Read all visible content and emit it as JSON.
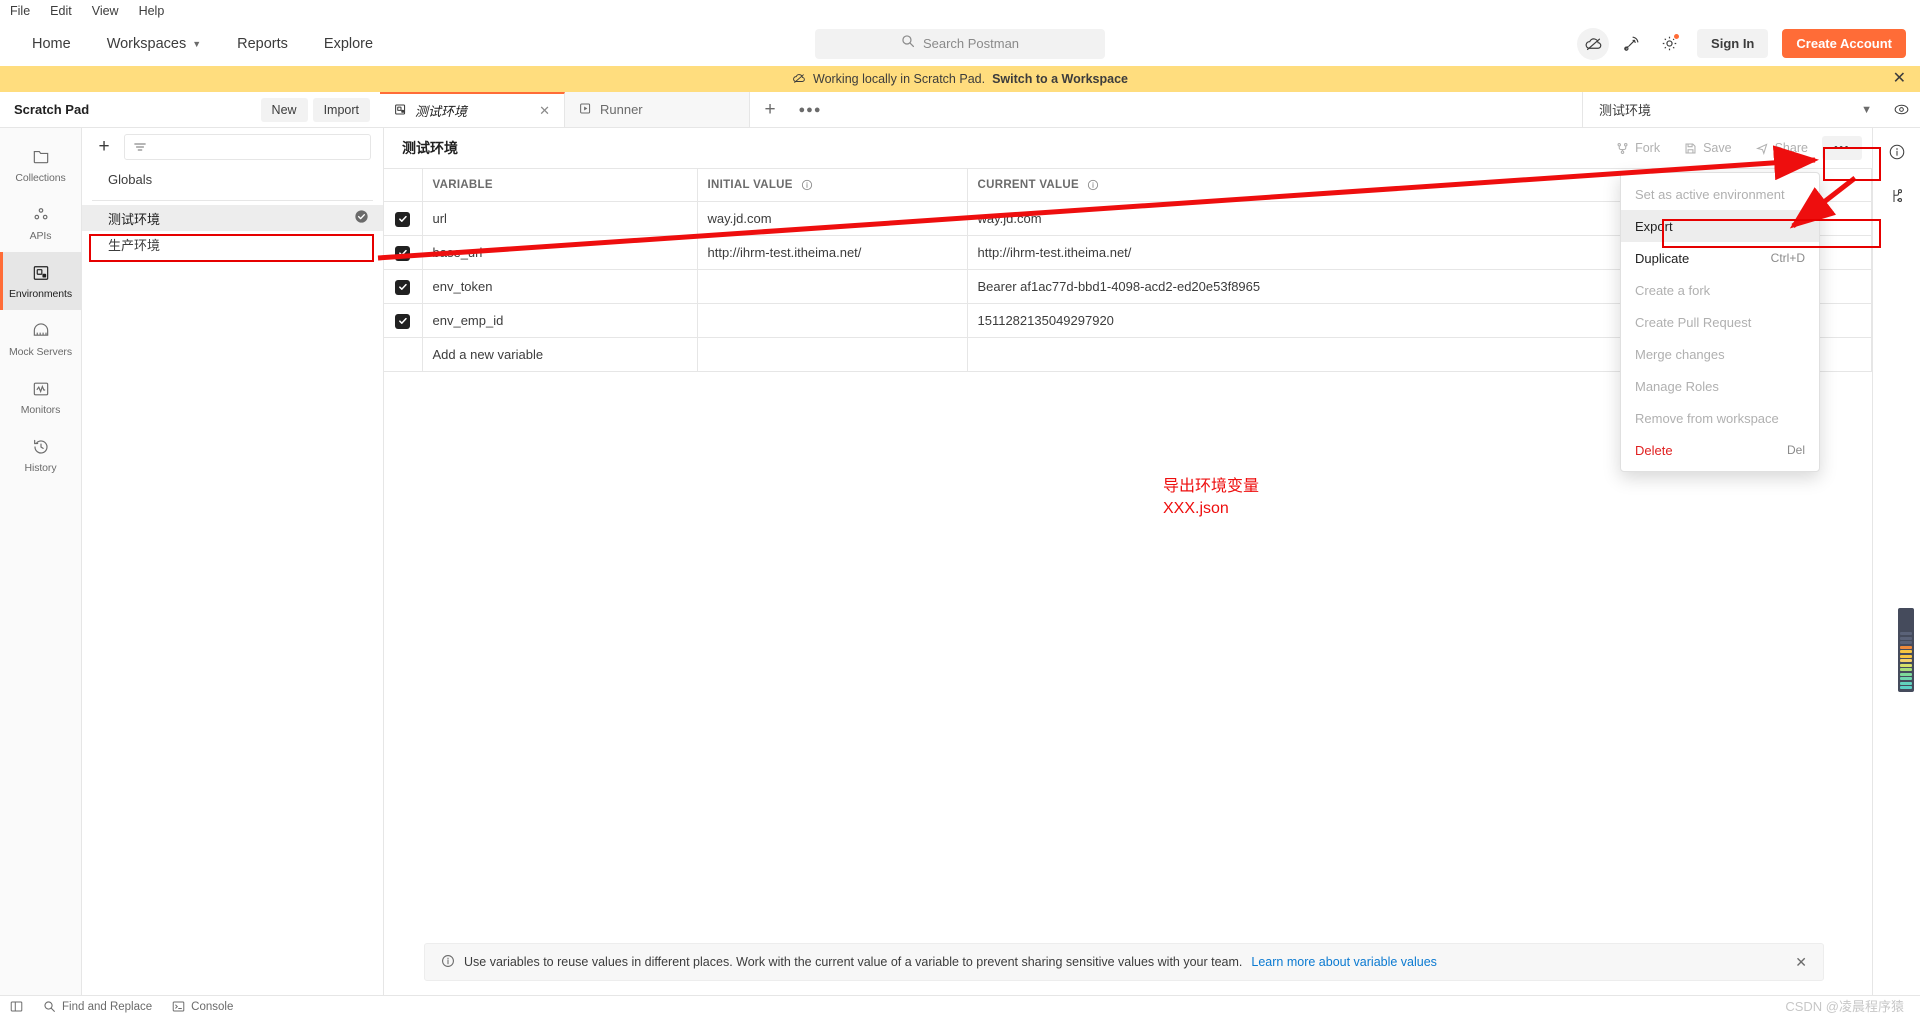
{
  "os_menu": [
    "File",
    "Edit",
    "View",
    "Help"
  ],
  "topnav": {
    "items": [
      {
        "label": "Home",
        "caret": false
      },
      {
        "label": "Workspaces",
        "caret": true
      },
      {
        "label": "Reports",
        "caret": false
      },
      {
        "label": "Explore",
        "caret": false
      }
    ],
    "search_placeholder": "Search Postman",
    "sign_in": "Sign In",
    "create_account": "Create Account",
    "icons": [
      "cloud-offline-icon",
      "satellite-icon",
      "gear-icon"
    ]
  },
  "banner": {
    "text": "Working locally in Scratch Pad.",
    "link": "Switch to a Workspace",
    "bg": "#ffdd7e"
  },
  "subheader": {
    "title": "Scratch Pad",
    "new_label": "New",
    "import_label": "Import"
  },
  "tabs": [
    {
      "label": "测试环境",
      "icon": "environment-icon",
      "active": true,
      "closeable": true
    },
    {
      "label": "Runner",
      "icon": "runner-icon",
      "active": false,
      "closeable": false
    }
  ],
  "env_selector": {
    "selected": "测试环境"
  },
  "sidebar": {
    "items": [
      {
        "label": "Collections",
        "icon": "collections-icon",
        "active": false
      },
      {
        "label": "APIs",
        "icon": "apis-icon",
        "active": false
      },
      {
        "label": "Environments",
        "icon": "environments-icon",
        "active": true
      },
      {
        "label": "Mock Servers",
        "icon": "mock-servers-icon",
        "active": false
      },
      {
        "label": "Monitors",
        "icon": "monitors-icon",
        "active": false
      },
      {
        "label": "History",
        "icon": "history-icon",
        "active": false
      }
    ]
  },
  "env_panel": {
    "filter_placeholder": "",
    "globals_label": "Globals",
    "environments": [
      {
        "label": "测试环境",
        "selected": true,
        "active_check": true
      },
      {
        "label": "生产环境",
        "selected": false,
        "active_check": false
      }
    ]
  },
  "main": {
    "title": "测试环境",
    "actions": [
      {
        "label": "Fork",
        "icon": "fork-icon"
      },
      {
        "label": "Save",
        "icon": "save-icon"
      },
      {
        "label": "Share",
        "icon": "share-icon"
      }
    ],
    "dots_label": "•••"
  },
  "table": {
    "headers": [
      "VARIABLE",
      "INITIAL VALUE",
      "CURRENT VALUE"
    ],
    "rows": [
      {
        "checked": true,
        "variable": "url",
        "initial": "way.jd.com",
        "current": "way.jd.com"
      },
      {
        "checked": true,
        "variable": "base_url",
        "initial": "http://ihrm-test.itheima.net/",
        "current": "http://ihrm-test.itheima.net/"
      },
      {
        "checked": true,
        "variable": "env_token",
        "initial": "",
        "current": "Bearer af1ac77d-bbd1-4098-acd2-ed20e53f8965"
      },
      {
        "checked": true,
        "variable": "env_emp_id",
        "initial": "",
        "current": "1511282135049297920"
      }
    ],
    "add_row_placeholder": "Add a new variable"
  },
  "context_menu": {
    "items": [
      {
        "label": "Set as active environment",
        "shortcut": "",
        "disabled": true,
        "highlight": false,
        "danger": false
      },
      {
        "label": "Export",
        "shortcut": "",
        "disabled": false,
        "highlight": true,
        "danger": false
      },
      {
        "label": "Duplicate",
        "shortcut": "Ctrl+D",
        "disabled": false,
        "highlight": false,
        "danger": false
      },
      {
        "label": "Create a fork",
        "shortcut": "",
        "disabled": true,
        "highlight": false,
        "danger": false
      },
      {
        "label": "Create Pull Request",
        "shortcut": "",
        "disabled": true,
        "highlight": false,
        "danger": false
      },
      {
        "label": "Merge changes",
        "shortcut": "",
        "disabled": true,
        "highlight": false,
        "danger": false
      },
      {
        "label": "Manage Roles",
        "shortcut": "",
        "disabled": true,
        "highlight": false,
        "danger": false
      },
      {
        "label": "Remove from workspace",
        "shortcut": "",
        "disabled": true,
        "highlight": false,
        "danger": false
      },
      {
        "label": "Delete",
        "shortcut": "Del",
        "disabled": false,
        "highlight": false,
        "danger": true
      }
    ]
  },
  "notice": {
    "text": "Use variables to reuse values in different places. Work with the current value of a variable to prevent sharing sensitive values with your team.",
    "link": "Learn more about variable values"
  },
  "status_bar": {
    "left": [
      {
        "label": "",
        "icon": "sidebar-toggle-icon"
      },
      {
        "label": "Find and Replace",
        "icon": "search-icon"
      },
      {
        "label": "Console",
        "icon": "console-icon"
      }
    ]
  },
  "annotations": {
    "note_line1": "导出环境变量",
    "note_line2": "XXX.json",
    "color": "#ee0e0e"
  },
  "watermark": "CSDN @凌晨程序猿"
}
